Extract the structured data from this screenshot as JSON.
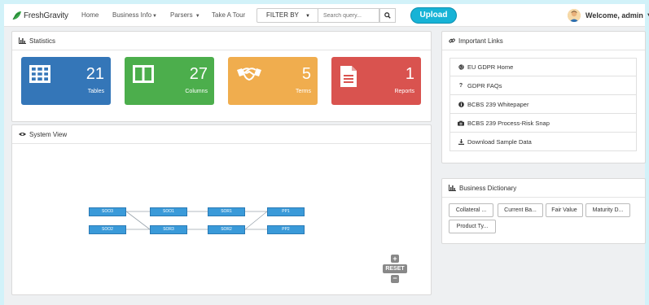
{
  "brand": {
    "name": "FreshGravity",
    "mark": "leaf-logo"
  },
  "nav": {
    "home": "Home",
    "business_info": "Business Info",
    "parsers": "Parsers",
    "take_a_tour": "Take A Tour"
  },
  "filter": {
    "label": "FILTER BY"
  },
  "search": {
    "placeholder": "Search query..."
  },
  "upload": {
    "label": "Upload"
  },
  "user": {
    "welcome": "Welcome, admin"
  },
  "statistics": {
    "title": "Statistics",
    "tiles": [
      {
        "value": "21",
        "label": "Tables",
        "color": "#3476b8",
        "icon": "table-icon"
      },
      {
        "value": "27",
        "label": "Columns",
        "color": "#4cae4c",
        "icon": "columns-icon"
      },
      {
        "value": "5",
        "label": "Terms",
        "color": "#f0ad4e",
        "icon": "handshake-icon"
      },
      {
        "value": "1",
        "label": "Reports",
        "color": "#d9534f",
        "icon": "document-icon"
      }
    ]
  },
  "system_view": {
    "title": "System View",
    "nodes": [
      "SOO3",
      "SOO2",
      "SOO1",
      "SOR3",
      "SOR1",
      "SOR2",
      "PP1",
      "PP2"
    ],
    "reset_label": "RESET"
  },
  "important_links": {
    "title": "Important Links",
    "items": [
      {
        "label": "EU GDPR Home",
        "icon": "globe-icon"
      },
      {
        "label": "GDPR FAQs",
        "icon": "question-icon"
      },
      {
        "label": "BCBS 239 Whitepaper",
        "icon": "info-circle-icon"
      },
      {
        "label": "BCBS 239 Process-Risk Snap",
        "icon": "camera-icon"
      },
      {
        "label": "Download Sample Data",
        "icon": "download-icon"
      }
    ]
  },
  "business_dictionary": {
    "title": "Business Dictionary",
    "terms": [
      "Collateral ...",
      "Current Ba...",
      "Fair Value",
      "Maturity D...",
      "Product Ty..."
    ]
  }
}
